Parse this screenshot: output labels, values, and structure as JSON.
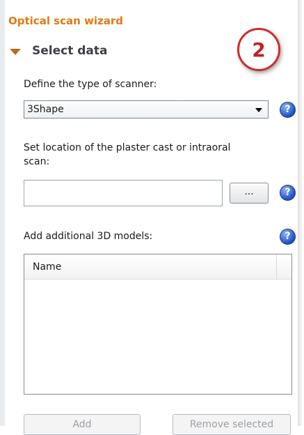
{
  "wizard": {
    "title": "Optical scan wizard",
    "step_badge": "2"
  },
  "section": {
    "title": "Select data"
  },
  "scanner": {
    "label": "Define the type of scanner:",
    "selected": "3Shape"
  },
  "location": {
    "label_line1": "Set location of the plaster cast or intraoral",
    "label_line2": "scan:",
    "value": "",
    "browse_label": "..."
  },
  "models": {
    "label": "Add additional 3D models:",
    "columns": [
      "Name"
    ]
  },
  "buttons": {
    "add": "Add",
    "remove_selected": "Remove selected"
  },
  "help_glyph": "?",
  "colors": {
    "title_orange": "#e07a10",
    "badge_red": "#d12a2a",
    "help_blue": "#1d4fc2"
  }
}
